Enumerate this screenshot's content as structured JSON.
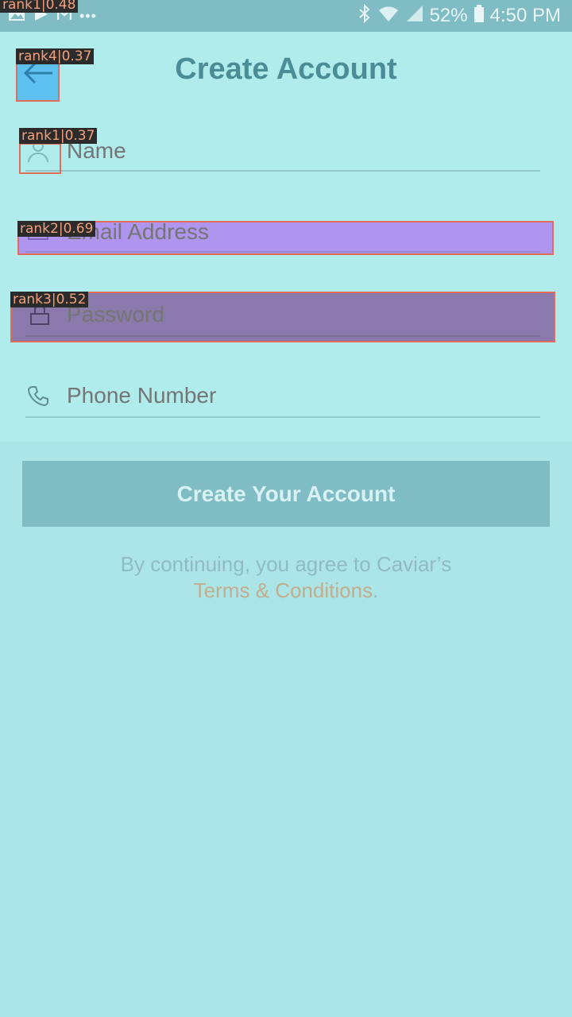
{
  "status_bar": {
    "battery": "52%",
    "time": "4:50 PM",
    "left_icons": [
      "image-icon",
      "play-icon",
      "gmail-icon",
      "more-icon"
    ],
    "right_icons": [
      "bluetooth-icon",
      "wifi-icon",
      "signal-icon",
      "battery-icon"
    ]
  },
  "header": {
    "title": "Create Account",
    "back_icon": "arrow-left-icon"
  },
  "form": {
    "name": {
      "placeholder": "Name",
      "icon": "person-icon"
    },
    "email": {
      "placeholder": "Email Address",
      "icon": "mail-icon"
    },
    "password": {
      "placeholder": "Password",
      "icon": "lock-icon"
    },
    "phone": {
      "placeholder": "Phone Number",
      "icon": "phone-icon"
    }
  },
  "submit_label": "Create Your Account",
  "terms": {
    "prefix": "By continuing, you agree to Caviar’s",
    "link": "Terms & Conditions",
    "suffix": "."
  },
  "annotations": [
    {
      "label": "rank1|0.48"
    },
    {
      "label": "rank4|0.37"
    },
    {
      "label": "rank1|0.37"
    },
    {
      "label": "rank2|0.69"
    },
    {
      "label": "rank3|0.52"
    }
  ],
  "colors": {
    "background": "#ace5e8",
    "accent": "#4b8d97",
    "button": "#7fbcc4",
    "link": "#c2ad8c",
    "highlight_email": "#b095ee",
    "highlight_password": "#8a7aac",
    "highlight_back": "#5ec0ee"
  }
}
